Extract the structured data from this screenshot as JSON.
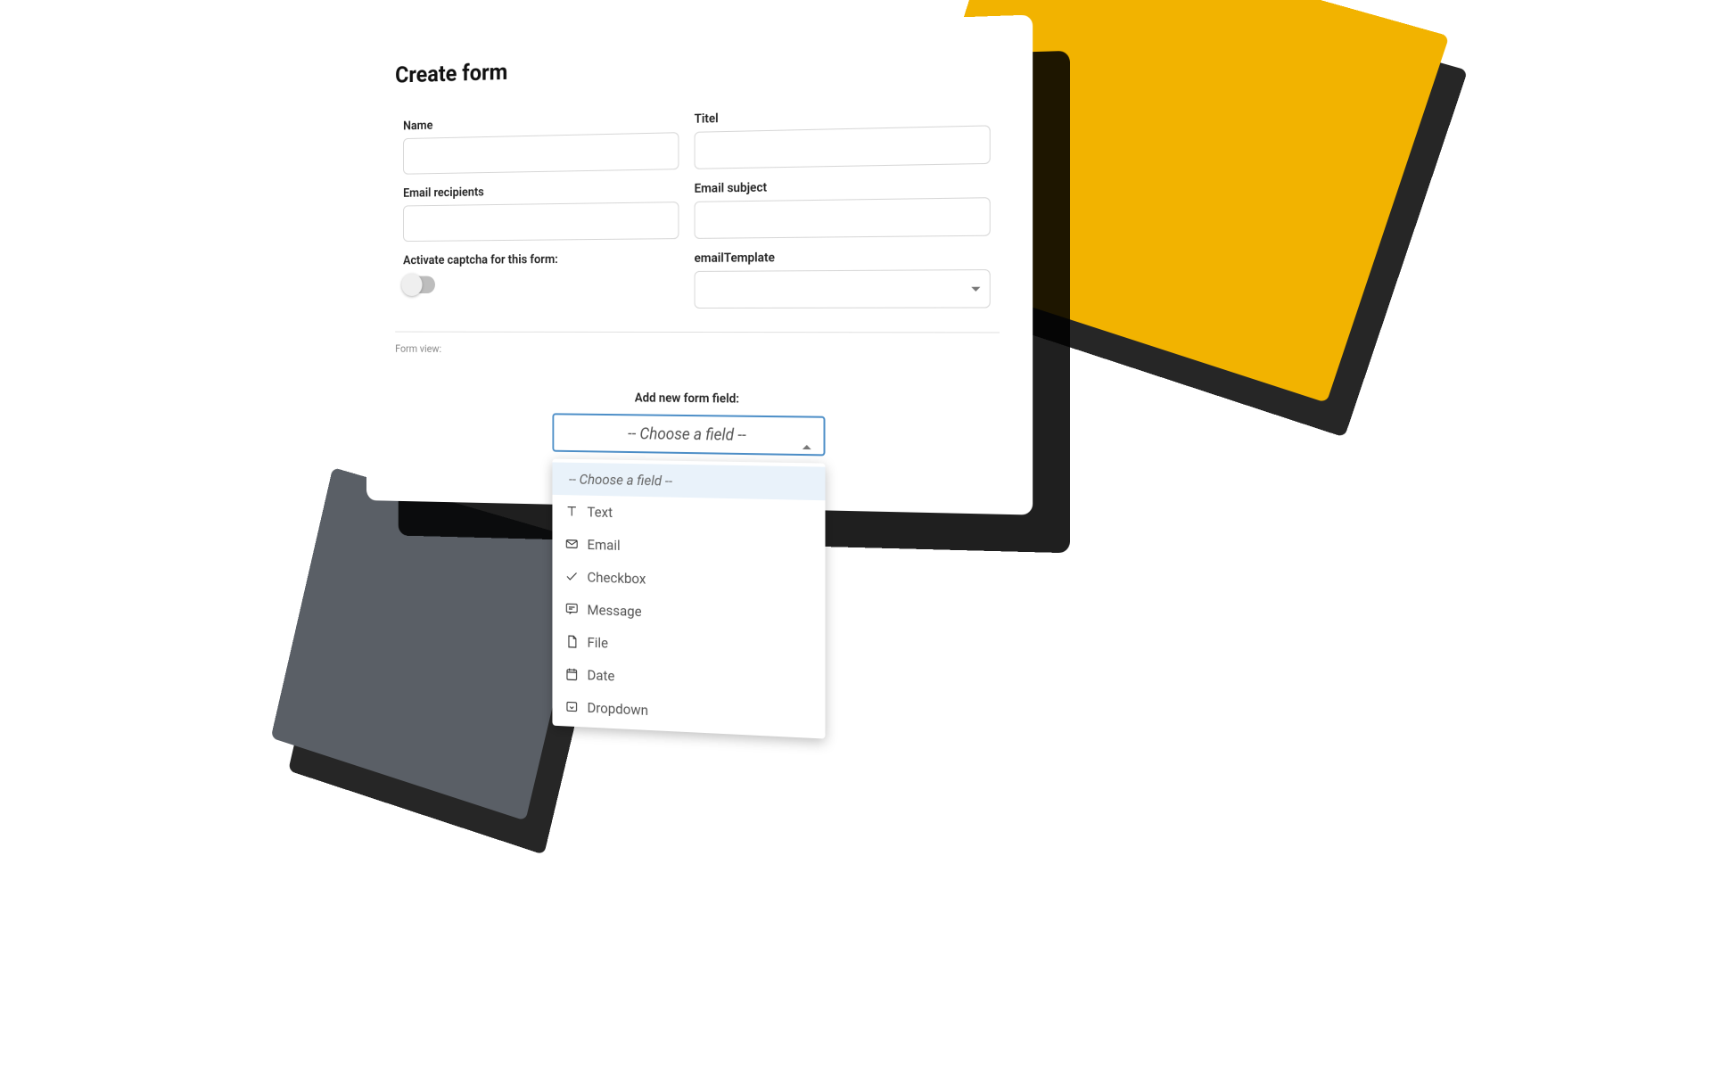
{
  "page": {
    "title": "Create form"
  },
  "fields": {
    "name": {
      "label": "Name",
      "value": ""
    },
    "titel": {
      "label": "Titel",
      "value": ""
    },
    "email_recipients": {
      "label": "Email recipients",
      "value": ""
    },
    "email_subject": {
      "label": "Email subject",
      "value": ""
    },
    "captcha": {
      "label": "Activate captcha for this form:",
      "on": false
    },
    "email_template": {
      "label": "emailTemplate",
      "value": ""
    }
  },
  "form_view": {
    "label": "Form view:"
  },
  "add_field": {
    "label": "Add new form field:",
    "placeholder": "-- Choose a field --",
    "options": [
      {
        "icon": "text-icon",
        "label": "Text"
      },
      {
        "icon": "envelope-icon",
        "label": "Email"
      },
      {
        "icon": "check-icon",
        "label": "Checkbox"
      },
      {
        "icon": "message-icon",
        "label": "Message"
      },
      {
        "icon": "file-icon",
        "label": "File"
      },
      {
        "icon": "calendar-icon",
        "label": "Date"
      },
      {
        "icon": "dropdown-icon",
        "label": "Dropdown"
      }
    ]
  }
}
